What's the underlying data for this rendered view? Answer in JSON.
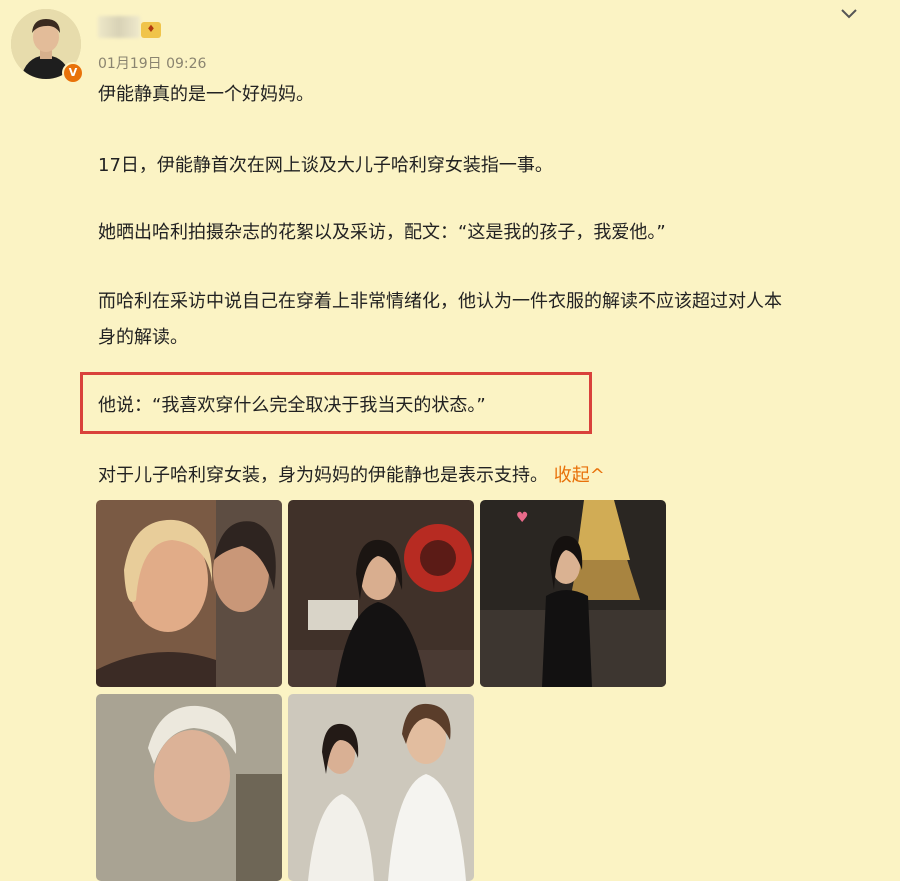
{
  "post": {
    "timestamp": "01月19日 09:26",
    "vip_badge_text": "♦",
    "verified_mark": "V",
    "paragraphs": [
      "伊能静真的是一个好妈妈。",
      "17日，伊能静首次在网上谈及大儿子哈利穿女装指一事。",
      "她晒出哈利拍摄杂志的花絮以及采访，配文：“这是我的孩子，我爱他。”",
      "而哈利在采访中说自己在穿着上非常情绪化，他认为一件衣服的解读不应该超过对人本",
      "身的解读。",
      "他说：“我喜欢穿什么完全取决于我当天的状态。”",
      "对于儿子哈利穿女装，身为妈妈的伊能静也是表示支持。"
    ],
    "collapse_label": "收起^"
  },
  "colors": {
    "background": "#fbf3c4",
    "highlight": "#d9413b",
    "link": "#e8710a"
  },
  "icons": [
    "chevron-down-icon",
    "verified-icon",
    "vip-badge-icon"
  ]
}
